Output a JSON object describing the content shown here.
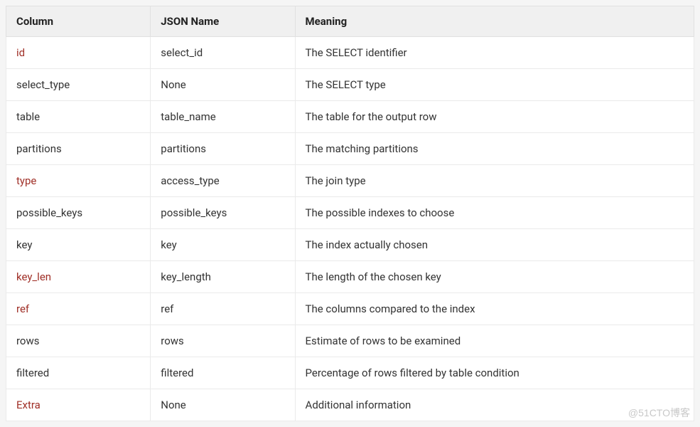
{
  "headers": {
    "col0": "Column",
    "col1": "JSON Name",
    "col2": "Meaning"
  },
  "rows": [
    {
      "column": "id",
      "highlight": true,
      "json_name": "select_id",
      "meaning": "The SELECT  identifier"
    },
    {
      "column": "select_type",
      "highlight": false,
      "json_name": "None",
      "meaning": "The SELECT  type"
    },
    {
      "column": "table",
      "highlight": false,
      "json_name": "table_name",
      "meaning": "The table  for the output row"
    },
    {
      "column": "partitions",
      "highlight": false,
      "json_name": "partitions",
      "meaning": "The  matching partitions"
    },
    {
      "column": "type",
      "highlight": true,
      "json_name": "access_type",
      "meaning": "The join  type"
    },
    {
      "column": "possible_keys",
      "highlight": false,
      "json_name": "possible_keys",
      "meaning": "The  possible indexes to choose"
    },
    {
      "column": "key",
      "highlight": false,
      "json_name": "key",
      "meaning": "The index  actually chosen"
    },
    {
      "column": "key_len",
      "highlight": true,
      "json_name": "key_length",
      "meaning": "The length  of the chosen key"
    },
    {
      "column": "ref",
      "highlight": true,
      "json_name": "ref",
      "meaning": "The  columns compared to the index"
    },
    {
      "column": "rows",
      "highlight": false,
      "json_name": "rows",
      "meaning": "Estimate  of rows to be examined"
    },
    {
      "column": "filtered",
      "highlight": false,
      "json_name": "filtered",
      "meaning": "Percentage  of rows filtered by table condition"
    },
    {
      "column": "Extra",
      "highlight": true,
      "json_name": "None",
      "meaning": "Additional  information"
    }
  ],
  "watermark": "@51CTO博客"
}
